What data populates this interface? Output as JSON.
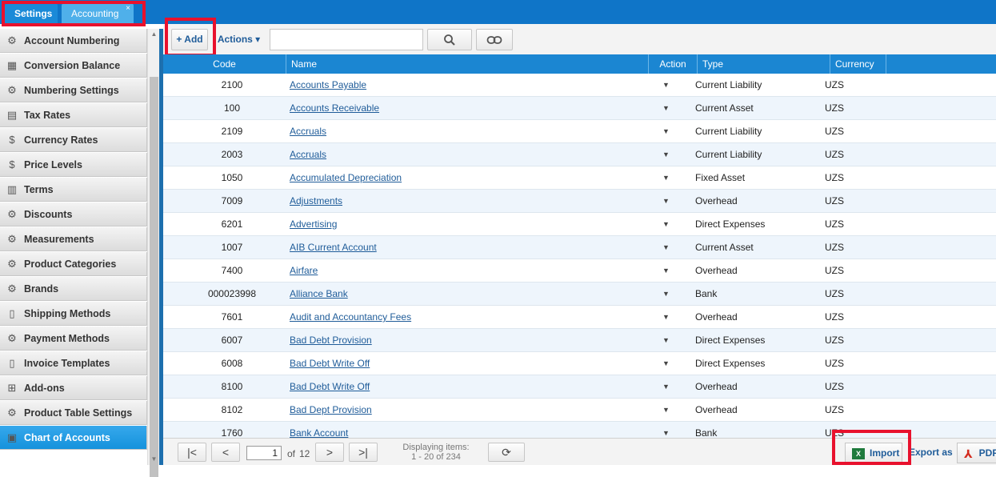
{
  "tabs": [
    {
      "label": "Settings"
    },
    {
      "label": "Accounting",
      "close": "×"
    }
  ],
  "sidebar": {
    "items": [
      {
        "label": "Account Numbering",
        "icon": "gears-dollar-icon",
        "glyph": "⚙"
      },
      {
        "label": "Conversion Balance",
        "icon": "calculator-icon",
        "glyph": "▦"
      },
      {
        "label": "Numbering Settings",
        "icon": "gears-dollar-icon",
        "glyph": "⚙"
      },
      {
        "label": "Tax Rates",
        "icon": "ledger-icon",
        "glyph": "▤"
      },
      {
        "label": "Currency Rates",
        "icon": "dollar-icon",
        "glyph": "$"
      },
      {
        "label": "Price Levels",
        "icon": "price-tag-icon",
        "glyph": "$"
      },
      {
        "label": "Terms",
        "icon": "document-icon",
        "glyph": "▥"
      },
      {
        "label": "Discounts",
        "icon": "gear-icon",
        "glyph": "⚙"
      },
      {
        "label": "Measurements",
        "icon": "gears-dollar-icon",
        "glyph": "⚙"
      },
      {
        "label": "Product Categories",
        "icon": "gears-dollar-icon",
        "glyph": "⚙"
      },
      {
        "label": "Brands",
        "icon": "gears-dollar-icon",
        "glyph": "⚙"
      },
      {
        "label": "Shipping Methods",
        "icon": "page-icon",
        "glyph": "▯"
      },
      {
        "label": "Payment Methods",
        "icon": "gears-dollar-icon",
        "glyph": "⚙"
      },
      {
        "label": "Invoice Templates",
        "icon": "page-icon",
        "glyph": "▯"
      },
      {
        "label": "Add-ons",
        "icon": "addons-icon",
        "glyph": "⊞"
      },
      {
        "label": "Product Table Settings",
        "icon": "gears-dollar-icon",
        "glyph": "⚙"
      },
      {
        "label": "Chart of Accounts",
        "icon": "chart-of-accounts-icon",
        "glyph": "▣",
        "active": true
      }
    ]
  },
  "toolbar": {
    "add_label": "+ Add",
    "actions_label": "Actions ▾",
    "search_placeholder": "",
    "search_icon": "search-icon",
    "link_icon": "link-icon"
  },
  "grid": {
    "columns": [
      "Code",
      "Name",
      "Action",
      "Type",
      "Currency"
    ],
    "rows": [
      {
        "code": "2100",
        "name": "Accounts Payable",
        "type": "Current Liability",
        "currency": "UZS"
      },
      {
        "code": "100",
        "name": "Accounts Receivable",
        "type": "Current Asset",
        "currency": "UZS"
      },
      {
        "code": "2109",
        "name": "Accruals",
        "type": "Current Liability",
        "currency": "UZS"
      },
      {
        "code": "2003",
        "name": "Accruals",
        "type": "Current Liability",
        "currency": "UZS"
      },
      {
        "code": "1050",
        "name": "Accumulated Depreciation",
        "type": "Fixed Asset",
        "currency": "UZS"
      },
      {
        "code": "7009",
        "name": "Adjustments",
        "type": "Overhead",
        "currency": "UZS"
      },
      {
        "code": "6201",
        "name": "Advertising",
        "type": "Direct Expenses",
        "currency": "UZS"
      },
      {
        "code": "1007",
        "name": "AIB Current Account",
        "type": "Current Asset",
        "currency": "UZS"
      },
      {
        "code": "7400",
        "name": "Airfare",
        "type": "Overhead",
        "currency": "UZS"
      },
      {
        "code": "000023998",
        "name": "Alliance Bank",
        "type": "Bank",
        "currency": "UZS"
      },
      {
        "code": "7601",
        "name": "Audit and Accountancy Fees",
        "type": "Overhead",
        "currency": "UZS"
      },
      {
        "code": "6007",
        "name": "Bad Debt Provision",
        "type": "Direct Expenses",
        "currency": "UZS"
      },
      {
        "code": "6008",
        "name": "Bad Debt Write Off",
        "type": "Direct Expenses",
        "currency": "UZS"
      },
      {
        "code": "8100",
        "name": "Bad Debt Write Off",
        "type": "Overhead",
        "currency": "UZS"
      },
      {
        "code": "8102",
        "name": "Bad Dept Provision",
        "type": "Overhead",
        "currency": "UZS"
      },
      {
        "code": "1760",
        "name": "Bank Account",
        "type": "Bank",
        "currency": "UZS"
      }
    ]
  },
  "pager": {
    "page": "1",
    "of_label": "of",
    "total_pages": "12",
    "displaying_label": "Displaying items:",
    "displaying_range": "1 - 20 of 234"
  },
  "export": {
    "import_label": "Import",
    "export_as_label": "Export as",
    "pdf_label": "PDF"
  }
}
